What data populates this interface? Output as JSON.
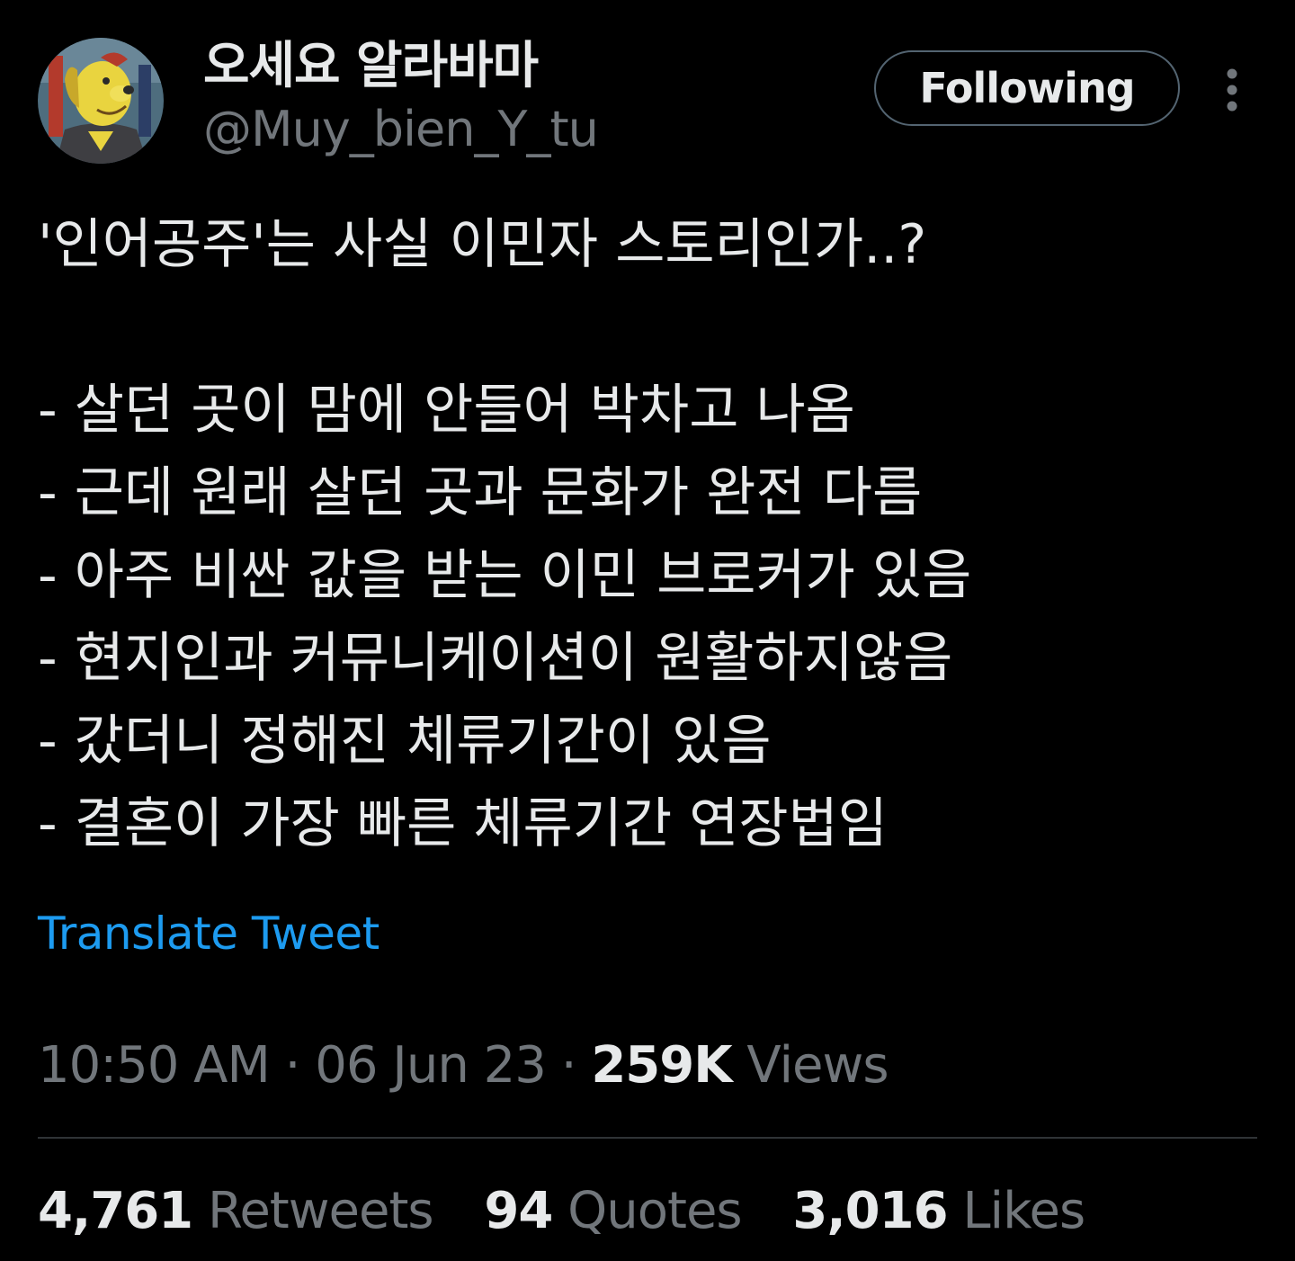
{
  "author": {
    "display_name": "오세요 알라바마",
    "handle": "@Muy_bien_Y_tu",
    "avatar_icon": "yellow-dog-avatar"
  },
  "follow_button": {
    "label": "Following"
  },
  "more_icon": "more-vertical-icon",
  "tweet": {
    "lines": [
      "'인어공주'는 사실 이민자 스토리인가..?",
      "",
      "- 살던 곳이 맘에 안들어 박차고 나옴",
      "- 근데 원래 살던 곳과 문화가 완전 다름",
      "- 아주 비싼 값을 받는 이민 브로커가 있음",
      "- 현지인과 커뮤니케이션이 원활하지않음",
      "- 갔더니 정해진 체류기간이 있음",
      "- 결혼이 가장 빠른 체류기간 연장법임"
    ]
  },
  "translate_label": "Translate Tweet",
  "meta": {
    "time": "10:50 AM",
    "separator": "·",
    "date": "06 Jun 23",
    "views_count": "259K",
    "views_label": "Views"
  },
  "stats": {
    "retweets": {
      "count": "4,761",
      "label": "Retweets"
    },
    "quotes": {
      "count": "94",
      "label": "Quotes"
    },
    "likes": {
      "count": "3,016",
      "label": "Likes"
    }
  },
  "colors": {
    "background": "#000000",
    "text_primary": "#e7e9ea",
    "text_secondary": "#71767b",
    "link": "#1d9bf0",
    "border": "#536471",
    "divider": "#2f3336"
  }
}
